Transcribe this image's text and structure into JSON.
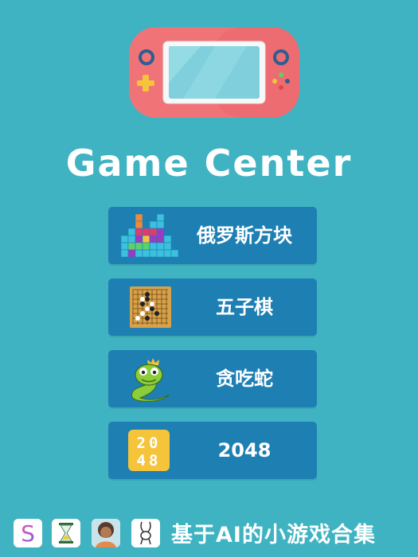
{
  "app": {
    "title": "Game Center"
  },
  "menu": {
    "items": [
      {
        "label": "俄罗斯方块",
        "icon": "tetris-icon"
      },
      {
        "label": "五子棋",
        "icon": "gomoku-board-icon"
      },
      {
        "label": "贪吃蛇",
        "icon": "snake-icon"
      },
      {
        "label": "2048",
        "icon": "2048-tile-icon"
      }
    ]
  },
  "tile_2048": {
    "top": "20",
    "bottom": "48"
  },
  "footer": {
    "tagline": "基于AI的小游戏合集",
    "badges": [
      "s-logo-icon",
      "hourglass-icon",
      "avatar-icon",
      "rabbit-icon"
    ],
    "s_letter": "S"
  },
  "colors": {
    "background": "#3fb3c2",
    "button": "#1e7fb3",
    "console": "#f07378",
    "screen": "#7fd0dc",
    "tile": "#f5c43a"
  }
}
